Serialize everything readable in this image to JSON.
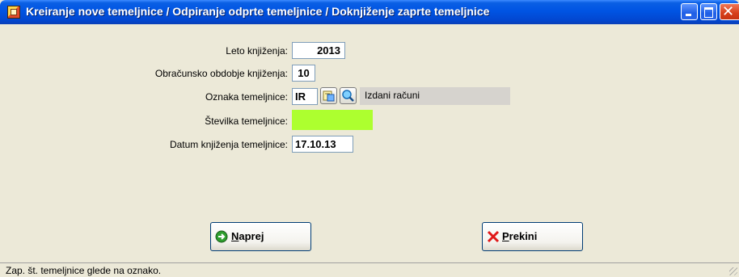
{
  "window": {
    "title": "Kreiranje nove temeljnice / Odpiranje odprte temeljnice / Doknjiženje zaprte temeljnice",
    "colors": {
      "titlebar": "#0054e3",
      "body": "#ece9d8",
      "highlight_field": "#adff2f"
    }
  },
  "form": {
    "year_label": "Leto knjiženja:",
    "year_value": "2013",
    "period_label": "Obračunsko obdobje knjiženja:",
    "period_value": "10",
    "journal_mark_label": "Oznaka temeljnice:",
    "journal_mark_value": "IR",
    "journal_mark_description": "Izdani računi",
    "journal_number_label": "Številka temeljnice:",
    "journal_number_value": "",
    "posting_date_label": "Datum knjiženja temeljnice:",
    "posting_date_value": "17.10.13",
    "icons": [
      "lookup-list-icon",
      "search-icon"
    ]
  },
  "buttons": {
    "next_label_accel": "N",
    "next_label_rest": "aprej",
    "next_icon": "green-arrow-icon",
    "cancel_label_accel": "P",
    "cancel_label_rest": "rekini",
    "cancel_icon": "red-x-icon"
  },
  "status": {
    "text": "Zap. št. temeljnice glede na oznako."
  }
}
